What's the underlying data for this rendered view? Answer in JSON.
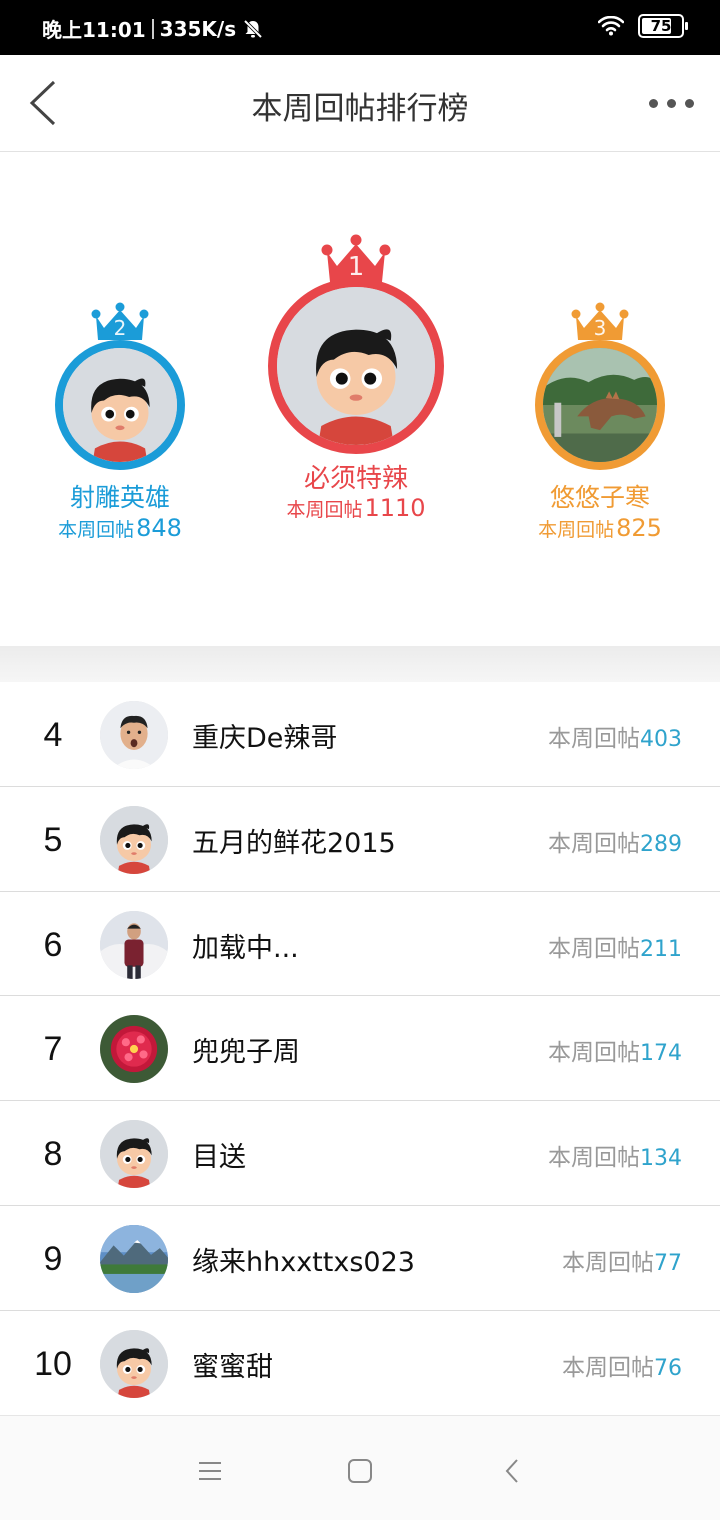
{
  "status_bar": {
    "time": "晚上11:01",
    "net_speed": "335K/s",
    "battery": "75",
    "battery_level": 0.75
  },
  "header": {
    "title": "本周回帖排行榜"
  },
  "colors": {
    "first": "#e8464a",
    "second": "#1b9cd8",
    "third": "#f09b34",
    "score_value": "#2fa3cc"
  },
  "podium": [
    {
      "rank": "2",
      "name": "射雕英雄",
      "label": "本周回帖",
      "score": "848",
      "avatar": "cartoon-boy-avatar"
    },
    {
      "rank": "1",
      "name": "必须特辣",
      "label": "本周回帖",
      "score": "1110",
      "avatar": "cartoon-boy-avatar"
    },
    {
      "rank": "3",
      "name": "悠悠子寒",
      "label": "本周回帖",
      "score": "825",
      "avatar": "dinosaur-photo-avatar"
    }
  ],
  "list": [
    {
      "rank": "4",
      "name": "重庆De辣哥",
      "label": "本周回帖",
      "score": "403",
      "avatar": "man-photo-avatar"
    },
    {
      "rank": "5",
      "name": "五月的鲜花2015",
      "label": "本周回帖",
      "score": "289",
      "avatar": "cartoon-boy-avatar"
    },
    {
      "rank": "6",
      "name": "加载中...",
      "label": "本周回帖",
      "score": "211",
      "avatar": "man-snow-photo-avatar"
    },
    {
      "rank": "7",
      "name": "兜兜子周",
      "label": "本周回帖",
      "score": "174",
      "avatar": "red-flower-avatar"
    },
    {
      "rank": "8",
      "name": "目送",
      "label": "本周回帖",
      "score": "134",
      "avatar": "cartoon-boy-avatar"
    },
    {
      "rank": "9",
      "name": "缘来hhxxttxs023",
      "label": "本周回帖",
      "score": "77",
      "avatar": "mountain-lake-avatar"
    },
    {
      "rank": "10",
      "name": "蜜蜜甜",
      "label": "本周回帖",
      "score": "76",
      "avatar": "cartoon-boy-avatar"
    }
  ]
}
